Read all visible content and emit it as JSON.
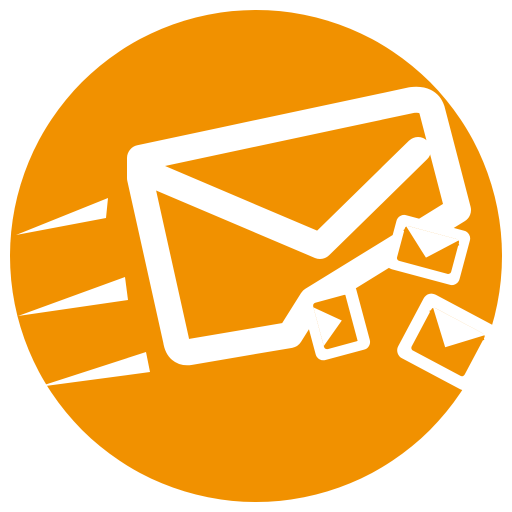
{
  "logo": {
    "icon": "mass-email-send-icon",
    "colors": {
      "background": "#ffffff",
      "circle": "#f19100",
      "glyph": "#ffffff"
    }
  }
}
